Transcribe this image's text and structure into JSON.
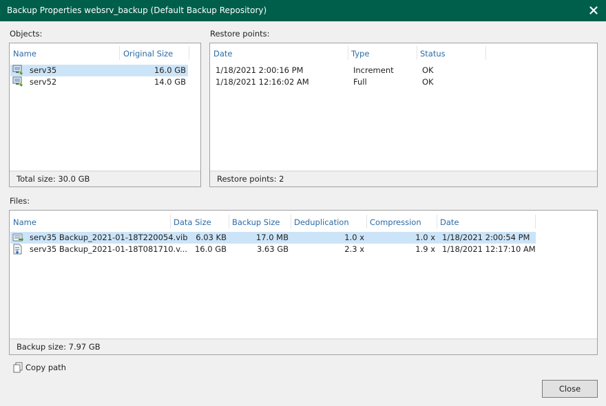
{
  "window": {
    "title": "Backup Properties websrv_backup (Default Backup Repository)"
  },
  "objects": {
    "label": "Objects:",
    "columns": [
      "Name",
      "Original Size"
    ],
    "rows": [
      {
        "name": "serv35",
        "size": "16.0 GB",
        "icon": "vm-icon"
      },
      {
        "name": "serv52",
        "size": "14.0 GB",
        "icon": "vm-icon"
      }
    ],
    "footer": "Total size: 30.0 GB"
  },
  "restore_points": {
    "label": "Restore points:",
    "columns": [
      "Date",
      "Type",
      "Status"
    ],
    "rows": [
      {
        "date": "1/18/2021 2:00:16 PM",
        "type": "Increment",
        "status": "OK"
      },
      {
        "date": "1/18/2021 12:16:02 AM",
        "type": "Full",
        "status": "OK"
      }
    ],
    "footer": "Restore points: 2"
  },
  "files": {
    "label": "Files:",
    "columns": [
      "Name",
      "Data Size",
      "Backup Size",
      "Deduplication",
      "Compression",
      "Date"
    ],
    "rows": [
      {
        "name": "serv35 Backup_2021-01-18T220054.vib",
        "data_size": "6.03 KB",
        "backup_size": "17.0 MB",
        "dedup": "1.0 x",
        "compression": "1.0 x",
        "date": "1/18/2021 2:00:54 PM",
        "icon": "incremental-file-icon"
      },
      {
        "name": "serv35 Backup_2021-01-18T081710.v...",
        "data_size": "16.0 GB",
        "backup_size": "3.63 GB",
        "dedup": "2.3 x",
        "compression": "1.9 x",
        "date": "1/18/2021 12:17:10 AM",
        "icon": "full-backup-file-icon"
      }
    ],
    "footer": "Backup size: 7.97 GB"
  },
  "actions": {
    "copy_path": "Copy path",
    "close": "Close"
  },
  "colors": {
    "titlebar": "#005f4b",
    "header_text": "#2a6aa6",
    "selection": "#cce4f7"
  }
}
